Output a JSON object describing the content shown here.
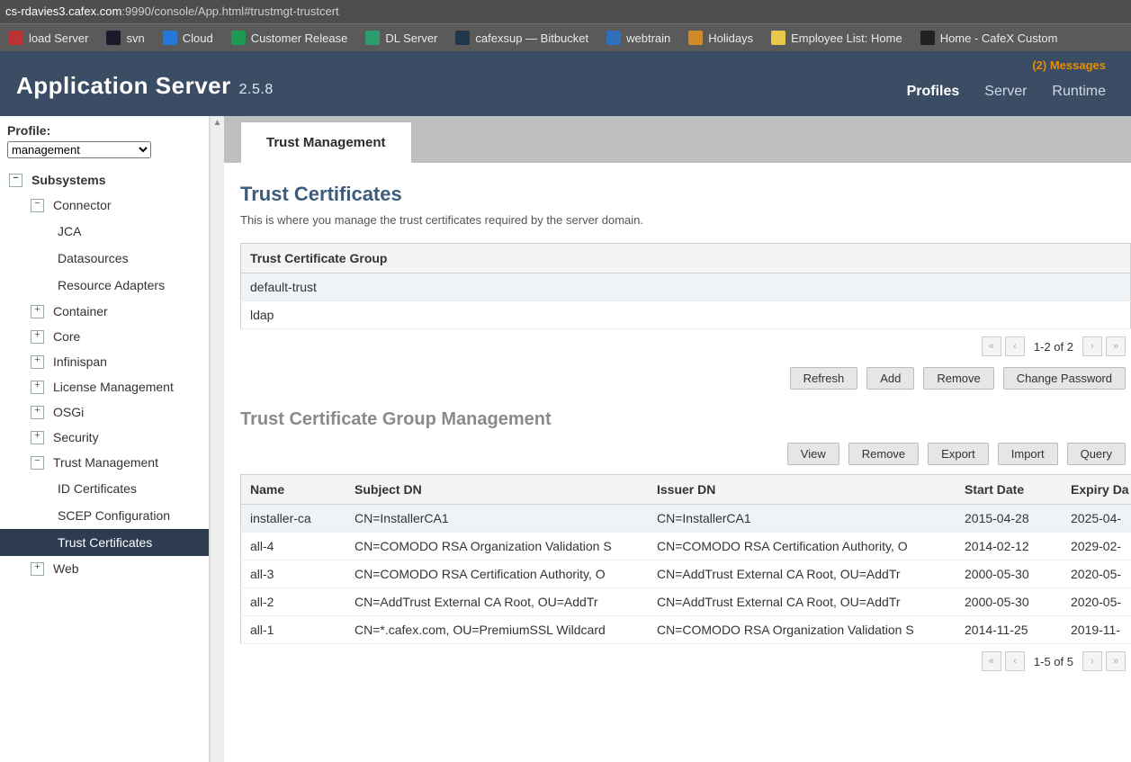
{
  "browser": {
    "url_pre": "cs-rdavies3.cafex.com",
    "url_post": ":9990/console/App.html#trustmgt-trustcert",
    "bookmarks": [
      {
        "label": "load Server",
        "color": "#b33"
      },
      {
        "label": "svn",
        "color": "#1a1a2e"
      },
      {
        "label": "Cloud",
        "color": "#2378d6"
      },
      {
        "label": "Customer Release",
        "color": "#1e9b52"
      },
      {
        "label": "DL Server",
        "color": "#2c9b6e"
      },
      {
        "label": "cafexsup — Bitbucket",
        "color": "#20364b"
      },
      {
        "label": "webtrain",
        "color": "#2f6fbb"
      },
      {
        "label": "Holidays",
        "color": "#d08a2a"
      },
      {
        "label": "Employee List: Home",
        "color": "#e6c84a"
      },
      {
        "label": "Home - CafeX Custom",
        "color": "#222"
      }
    ]
  },
  "header": {
    "messages": "(2) Messages",
    "title_bold": "Application Server",
    "version": "2.5.8",
    "nav": [
      {
        "label": "Profiles",
        "active": true
      },
      {
        "label": "Server",
        "active": false
      },
      {
        "label": "Runtime",
        "active": false
      }
    ]
  },
  "sidebar": {
    "profile_label": "Profile:",
    "profile_value": "management",
    "tree": [
      {
        "label": "Subsystems",
        "type": "root",
        "icon": "minus"
      },
      {
        "label": "Connector",
        "type": "l1",
        "icon": "minus"
      },
      {
        "label": "JCA",
        "type": "leaf"
      },
      {
        "label": "Datasources",
        "type": "leaf"
      },
      {
        "label": "Resource Adapters",
        "type": "leaf"
      },
      {
        "label": "Container",
        "type": "l1",
        "icon": "plus"
      },
      {
        "label": "Core",
        "type": "l1",
        "icon": "plus"
      },
      {
        "label": "Infinispan",
        "type": "l1",
        "icon": "plus"
      },
      {
        "label": "License Management",
        "type": "l1",
        "icon": "plus"
      },
      {
        "label": "OSGi",
        "type": "l1",
        "icon": "plus"
      },
      {
        "label": "Security",
        "type": "l1",
        "icon": "plus"
      },
      {
        "label": "Trust Management",
        "type": "l1",
        "icon": "minus"
      },
      {
        "label": "ID Certificates",
        "type": "leaf"
      },
      {
        "label": "SCEP Configuration",
        "type": "leaf"
      },
      {
        "label": "Trust Certificates",
        "type": "leaf",
        "active": true
      },
      {
        "label": "Web",
        "type": "l1",
        "icon": "plus"
      }
    ]
  },
  "main": {
    "tab": "Trust Management",
    "h1": "Trust Certificates",
    "desc": "This is where you manage the trust certificates required by the server domain.",
    "group_table": {
      "header": "Trust Certificate Group",
      "rows": [
        {
          "name": "default-trust",
          "selected": true
        },
        {
          "name": "ldap",
          "selected": false
        }
      ],
      "pager": "1-2 of 2"
    },
    "group_buttons": [
      "Refresh",
      "Add",
      "Remove",
      "Change Password"
    ],
    "h2": "Trust Certificate Group Management",
    "cert_buttons": [
      "View",
      "Remove",
      "Export",
      "Import",
      "Query"
    ],
    "cert_table": {
      "headers": [
        "Name",
        "Subject DN",
        "Issuer DN",
        "Start Date",
        "Expiry Da"
      ],
      "rows": [
        {
          "c": [
            "installer-ca",
            "CN=InstallerCA1",
            "CN=InstallerCA1",
            "2015-04-28",
            "2025-04-"
          ],
          "sel": true
        },
        {
          "c": [
            "all-4",
            "CN=COMODO RSA Organization Validation S",
            "CN=COMODO RSA Certification Authority, O",
            "2014-02-12",
            "2029-02-"
          ],
          "sel": false
        },
        {
          "c": [
            "all-3",
            "CN=COMODO RSA Certification Authority, O",
            "CN=AddTrust External CA Root, OU=AddTr",
            "2000-05-30",
            "2020-05-"
          ],
          "sel": false
        },
        {
          "c": [
            "all-2",
            "CN=AddTrust External CA Root, OU=AddTr",
            "CN=AddTrust External CA Root, OU=AddTr",
            "2000-05-30",
            "2020-05-"
          ],
          "sel": false
        },
        {
          "c": [
            "all-1",
            "CN=*.cafex.com, OU=PremiumSSL Wildcard",
            "CN=COMODO RSA Organization Validation S",
            "2014-11-25",
            "2019-11-"
          ],
          "sel": false
        }
      ],
      "pager": "1-5 of 5"
    }
  }
}
